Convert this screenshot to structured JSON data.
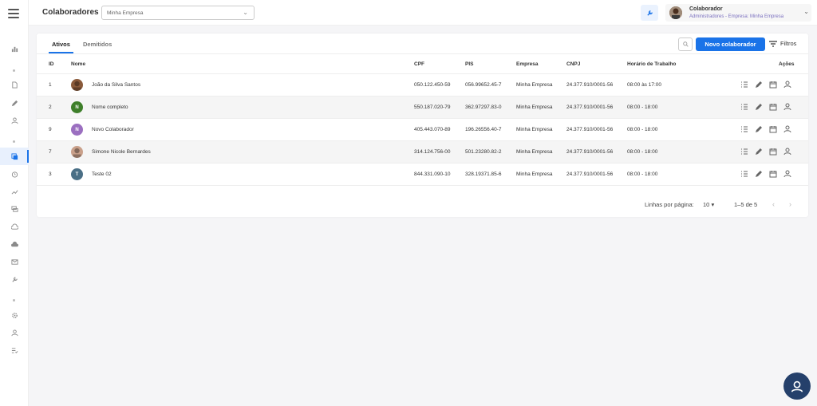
{
  "header": {
    "title": "Colaboradores",
    "company_select": "Minha Empresa",
    "user_name": "Colaborador",
    "user_role": "Administradores - Empresa: Minha Empresa"
  },
  "tabs": [
    {
      "label": "Ativos",
      "active": true
    },
    {
      "label": "Demitidos",
      "active": false
    }
  ],
  "toolbar": {
    "new_button": "Novo colaborador",
    "filter_button": "Filtros"
  },
  "table": {
    "columns": [
      "ID",
      "Nome",
      "CPF",
      "PIS",
      "Empresa",
      "CNPJ",
      "Horário de Trabalho",
      "Ações"
    ],
    "rows": [
      {
        "id": "1",
        "name": "João da Silva Santos",
        "avatar": "photo",
        "avatar_letter": "",
        "avatar_color": "#8a5a3a",
        "cpf": "050.122.450-59",
        "pis": "056.99652.45-7",
        "empresa": "Minha Empresa",
        "cnpj": "24.377.910/0001-56",
        "horario": "08:00 às 17:00"
      },
      {
        "id": "2",
        "name": "Nome completo",
        "avatar": "letter",
        "avatar_letter": "N",
        "avatar_color": "#3e7f2a",
        "cpf": "550.187.020-79",
        "pis": "362.97297.83-0",
        "empresa": "Minha Empresa",
        "cnpj": "24.377.910/0001-56",
        "horario": "08:00 - 18:00"
      },
      {
        "id": "9",
        "name": "Novo Colaborador",
        "avatar": "letter",
        "avatar_letter": "N",
        "avatar_color": "#9b6fc0",
        "cpf": "405.443.070-89",
        "pis": "196.26556.40-7",
        "empresa": "Minha Empresa",
        "cnpj": "24.377.910/0001-56",
        "horario": "08:00 - 18:00"
      },
      {
        "id": "7",
        "name": "Simone Nicole Bernardes",
        "avatar": "photo",
        "avatar_letter": "",
        "avatar_color": "#c9a08a",
        "cpf": "314.124.756-00",
        "pis": "501.23280.82-2",
        "empresa": "Minha Empresa",
        "cnpj": "24.377.910/0001-56",
        "horario": "08:00 - 18:00"
      },
      {
        "id": "3",
        "name": "Teste 02",
        "avatar": "letter",
        "avatar_letter": "T",
        "avatar_color": "#4a6f86",
        "cpf": "844.331.090-10",
        "pis": "328.19371.85-6",
        "empresa": "Minha Empresa",
        "cnpj": "24.377.910/0001-56",
        "horario": "08:00 - 18:00"
      }
    ]
  },
  "pagination": {
    "rows_per_page_label": "Linhas por página:",
    "rows_per_page": "10",
    "range": "1–5 de 5"
  },
  "colors": {
    "primary": "#1a73e8",
    "help_button": "#25406b",
    "role_text": "#7a6fbf"
  },
  "sidebar_icons": [
    "bar-chart-icon",
    "document-icon",
    "pencil-icon",
    "person-icon",
    "copy-icon",
    "alarm-icon",
    "trend-icon",
    "chat-icon",
    "cloud-upload-icon",
    "cloud-download-icon",
    "mail-icon",
    "wrench-icon",
    "gear-icon",
    "person-icon",
    "checklist-icon"
  ]
}
